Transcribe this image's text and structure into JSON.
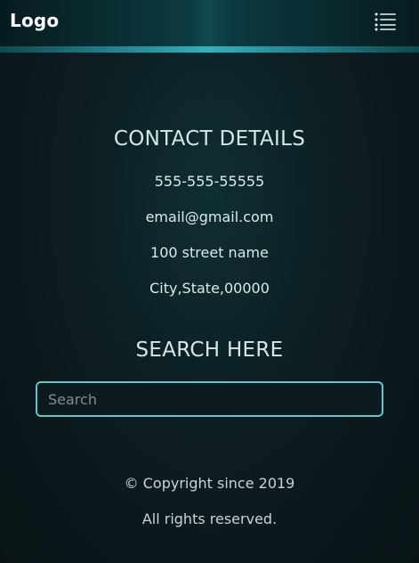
{
  "header": {
    "logo_text": "Logo",
    "menu_icon": "menu-list-icon"
  },
  "contact": {
    "title": "CONTACT DETAILS",
    "phone": "555-555-55555",
    "email": "email@gmail.com",
    "street": "100 street name",
    "city": "City,State,00000"
  },
  "search": {
    "title": "SEARCH HERE",
    "placeholder": "Search",
    "value": ""
  },
  "footer": {
    "copyright": "© Copyright since 2019",
    "rights": "All rights reserved."
  },
  "colors": {
    "accent": "#5fc8cf",
    "background": "#0c1d21"
  }
}
